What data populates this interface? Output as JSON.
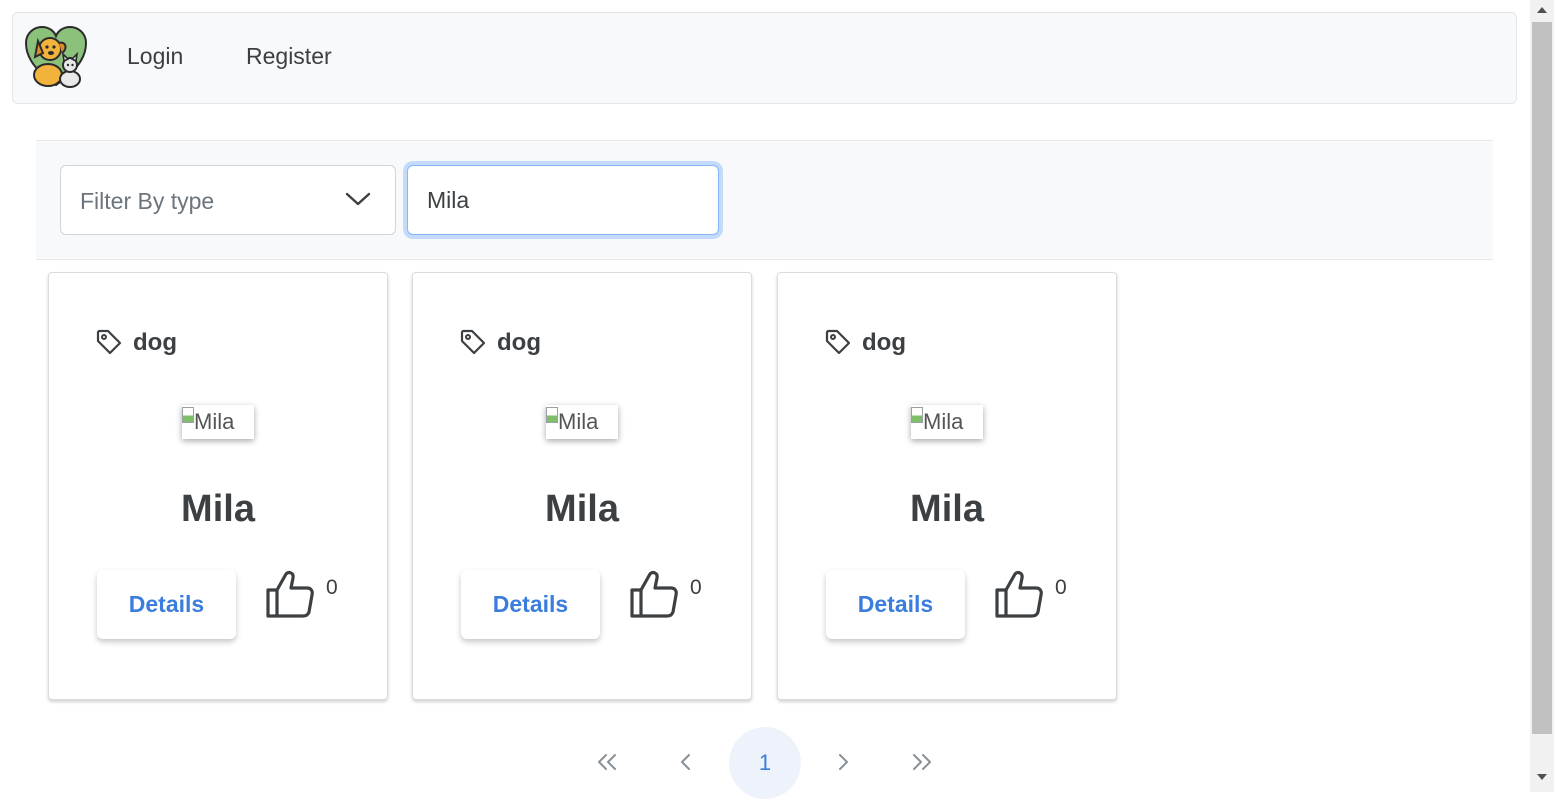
{
  "nav": {
    "login": "Login",
    "register": "Register"
  },
  "filter": {
    "type_placeholder": "Filter By type",
    "search_value": "Mila"
  },
  "cards": [
    {
      "type": "dog",
      "image_alt": "Mila",
      "name": "Mila",
      "details_label": "Details",
      "likes": "0"
    },
    {
      "type": "dog",
      "image_alt": "Mila",
      "name": "Mila",
      "details_label": "Details",
      "likes": "0"
    },
    {
      "type": "dog",
      "image_alt": "Mila",
      "name": "Mila",
      "details_label": "Details",
      "likes": "0"
    }
  ],
  "pagination": {
    "current_page": "1"
  },
  "colors": {
    "accent": "#3b7ddd",
    "navbar_bg": "#f8f9fa",
    "text": "#3c4043",
    "focus_border": "#86b7fe"
  },
  "icons": {
    "logo": "dog-cat-heart-logo",
    "tag": "tag-icon",
    "like": "thumbs-up-icon",
    "select": "chevron-down-icon"
  }
}
